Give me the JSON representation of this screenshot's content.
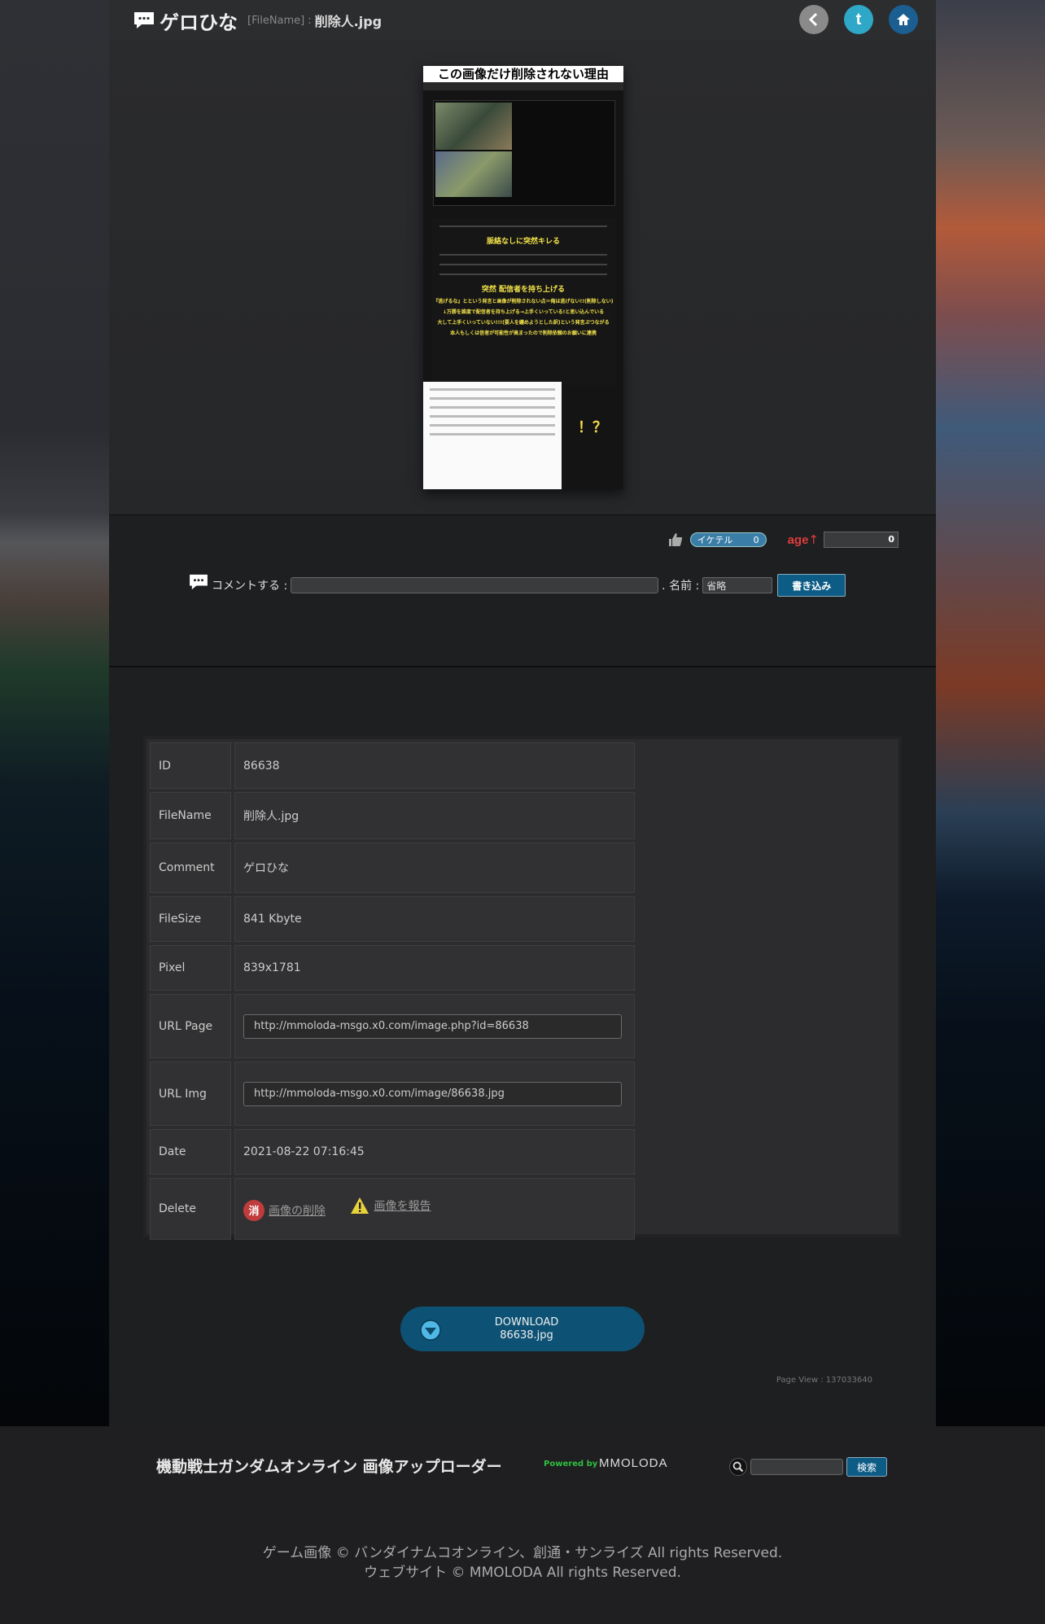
{
  "header": {
    "title": "ゲロひな",
    "filename_label": "[FileName]",
    "filename_sep": ":",
    "filename_value": "削除人.jpg",
    "icons": [
      "back-icon",
      "twitter-icon",
      "home-icon"
    ]
  },
  "preview": {
    "title": "この画像だけ削除されない理由",
    "text_1": "脈絡なしに突然キレる",
    "text_2": "突然 配信者を持ち上げる",
    "text_3": "『逃げるな』とという発言と画像が削除されない点＝俺は逃げない!!(削除しない)",
    "text_4": "↓万勝を誰度で配信者を持ち上げる→上手くいっている!と思い込んでいる",
    "text_5": "大して上手くいっていない!!!(要人を纏めようとした訳)という発言ぷつながる",
    "text_6": "本人もしくは信者が可能性が高まったので削除依頼のお願いに連携",
    "exclaim": "！？"
  },
  "reactions": {
    "like_label": "イケテル",
    "like_count": "0",
    "age_label": "age",
    "age_arrow": "↑",
    "age_count": "0"
  },
  "comment": {
    "label": "コメントする :",
    "name_label": ". 名前 :",
    "name_value": "省略",
    "submit_label": "書き込み"
  },
  "info": {
    "rows": [
      {
        "key": "ID",
        "value": "86638"
      },
      {
        "key": "FileName",
        "value": "削除人.jpg"
      },
      {
        "key": "Comment",
        "value": "ゲロひな"
      },
      {
        "key": "FileSize",
        "value": "841 Kbyte"
      },
      {
        "key": "Pixel",
        "value": "839x1781"
      },
      {
        "key": "URL Page",
        "value": "http://mmoloda-msgo.x0.com/image.php?id=86638"
      },
      {
        "key": "URL Img",
        "value": "http://mmoloda-msgo.x0.com/image/86638.jpg"
      },
      {
        "key": "Date",
        "value": "2021-08-22 07:16:45"
      },
      {
        "key": "Delete",
        "value": ""
      }
    ],
    "delete_badge": "消",
    "delete_link": "画像の削除",
    "report_link": "画像を報告"
  },
  "download": {
    "line1": "DOWNLOAD",
    "line2": "86638.jpg"
  },
  "pageview": "Page View : 137033640",
  "footer": {
    "title": "機動戦士ガンダムオンライン 画像アップローダー",
    "powered": "Powered by",
    "brand": "MMOLODA",
    "search_button": "検索",
    "copyright_1": "ゲーム画像 © バンダイナムコオンライン、創通・サンライズ All rights Reserved.",
    "copyright_2": "ウェブサイト © MMOLODA All rights Reserved."
  },
  "colors": {
    "accent_blue": "#0d5c86",
    "age_red": "#e03c3c",
    "powered_green": "#2fbf3f"
  }
}
